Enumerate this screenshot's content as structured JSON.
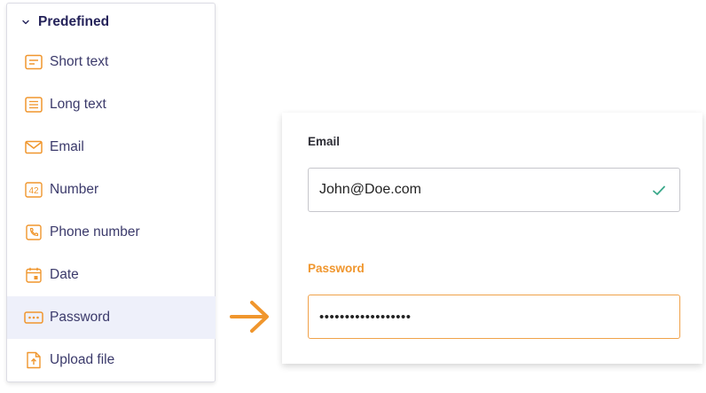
{
  "panel": {
    "title": "Predefined",
    "items": [
      {
        "label": "Short text",
        "icon": "short-text-icon"
      },
      {
        "label": "Long text",
        "icon": "long-text-icon"
      },
      {
        "label": "Email",
        "icon": "email-icon"
      },
      {
        "label": "Number",
        "icon": "number-icon",
        "icon_text": "42"
      },
      {
        "label": "Phone number",
        "icon": "phone-icon"
      },
      {
        "label": "Date",
        "icon": "date-icon"
      },
      {
        "label": "Password",
        "icon": "password-icon",
        "selected": true
      },
      {
        "label": "Upload file",
        "icon": "upload-file-icon"
      }
    ]
  },
  "form": {
    "email": {
      "label": "Email",
      "value": "John@Doe.com",
      "status": "valid"
    },
    "password": {
      "label": "Password",
      "value": "••••••••••••••••••",
      "focused": true
    }
  },
  "colors": {
    "accent": "#f0962d",
    "nav_text": "#3b3a6b",
    "title_text": "#25235a",
    "selected_bg": "#eef0fa",
    "valid_check": "#3aa88a"
  }
}
